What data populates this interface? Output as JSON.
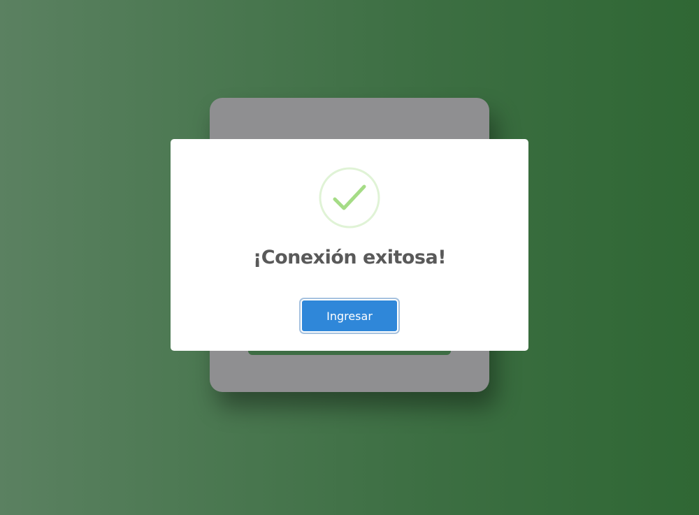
{
  "dialog": {
    "icon": "success-check-icon",
    "title": "¡Conexión exitosa!",
    "confirm_label": "Ingresar"
  },
  "colors": {
    "background_start": "#5b8161",
    "background_end": "#2f6734",
    "card": "#8f8f91",
    "dialog": "#ffffff",
    "success_ring": "#e0f3d6",
    "success_check": "#a5dc86",
    "button": "#2f87d9",
    "title_text": "#595959"
  }
}
